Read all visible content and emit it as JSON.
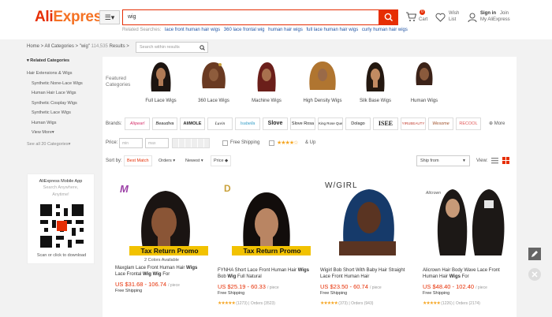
{
  "header": {
    "logo": "AliExpress",
    "menu_label": "☰▾",
    "search_value": "wig",
    "related_label": "Related Searches:",
    "related": [
      "lace front human hair wigs",
      "360 lace frontal wig",
      "human hair wigs",
      "full lace human hair wigs",
      "curly human hair wigs"
    ],
    "cart_label": "Cart",
    "cart_count": "0",
    "wish_line1": "Wish",
    "wish_line2": "List",
    "signin": "Sign in",
    "join": "Join",
    "my_ali": "My AliExpress"
  },
  "breadcrumb": {
    "path": "Home > All Categories > \"wig\"",
    "count": "114,535",
    "suffix": "Results >",
    "search_placeholder": "Search within results"
  },
  "sidebar": {
    "title": "▾ Related Categories",
    "items": [
      {
        "label": "Hair Extensions & Wigs",
        "indent": false
      },
      {
        "label": "Synthetic None-Lace Wigs",
        "indent": true
      },
      {
        "label": "Human Hair Lace Wigs",
        "indent": true
      },
      {
        "label": "Synthetic Cosplay Wigs",
        "indent": true
      },
      {
        "label": "Synthetic Lace Wigs",
        "indent": true
      },
      {
        "label": "Human Wigs",
        "indent": true
      },
      {
        "label": "View More▾",
        "indent": true
      }
    ],
    "see_all": "See all 20 Categories▾"
  },
  "mobile": {
    "title": "AliExpress Mobile App",
    "sub1": "Search Anywhere,",
    "sub2": "Anytime!",
    "cta": "Scan or click to download"
  },
  "featured": {
    "label_line1": "Featured",
    "label_line2": "Categories",
    "items": [
      "Full Lace Wigs",
      "360 Lace Wigs",
      "Machine Wigs",
      "High Density Wigs",
      "Silk Base Wigs",
      "Human Wigs"
    ]
  },
  "brands": {
    "label": "Brands:",
    "items": [
      "Alipearl",
      "Beaudiva",
      "AliMOLE",
      "Luvin",
      "Isabella",
      "Slove",
      "Slove Rosa",
      "King Rose Queen",
      "Dolago",
      "ISEE",
      "YIRUBEAUTY",
      "Wesome",
      "RECOOL"
    ],
    "more": "⊕ More"
  },
  "price_filter": {
    "label": "Price:",
    "min": "min",
    "max": "max",
    "free_shipping": "Free Shipping",
    "stars": "★★★★☆",
    "and_up": "& Up"
  },
  "sort": {
    "label": "Sort by:",
    "options": [
      "Best Match",
      "Orders ▾",
      "Newest ▾",
      "Price ◆"
    ],
    "ship_from": "Ship from",
    "view_label": "View:"
  },
  "products": [
    {
      "brand_mark": "M",
      "promo": "Tax Return Promo",
      "colors": "2 Colors Available",
      "title_pre": "Maxglam Lace Front Human Hair",
      "title_bold": "Wigs",
      "title_mid": "Lace Frontal",
      "title_bold2": "Wig Wig",
      "title_end": "For",
      "price": "US $31.68 - 106.74",
      "unit": "/ piece",
      "ship": "Free Shipping",
      "rating": "",
      "reviews": "",
      "orders": ""
    },
    {
      "brand_mark": "D",
      "promo": "Tax Return Promo",
      "colors": "",
      "title_pre": "FYNHA Short Lace Front Human Hair",
      "title_bold": "Wigs",
      "title_mid": "Bob",
      "title_bold2": "Wig",
      "title_end": "Full Natural",
      "price": "US $25.19 - 60.33",
      "unit": "/ piece",
      "ship": "Free Shipping",
      "rating": "★★★★★",
      "reviews": "(1273)",
      "orders": "Orders (3523)"
    },
    {
      "brand_mark": "W/GIRL",
      "promo": "",
      "colors": "",
      "title_pre": "Wigirl Bob Short With Baby Hair Straight Lace Front Human Hair",
      "title_bold": "",
      "title_mid": "",
      "title_bold2": "",
      "title_end": "",
      "price": "US $23.50 - 60.74",
      "unit": "/ piece",
      "ship": "Free Shipping",
      "rating": "★★★★★",
      "reviews": "(373)",
      "orders": "Orders (943)"
    },
    {
      "brand_mark": "Alicrown",
      "promo": "",
      "colors": "",
      "title_pre": "Alicrown Hair Body Wave Lace Front Human Hair",
      "title_bold": "Wigs",
      "title_mid": "For",
      "title_bold2": "",
      "title_end": "",
      "price": "US $48.40 - 102.40",
      "unit": "/ piece",
      "ship": "Free Shipping",
      "rating": "★★★★★",
      "reviews": "(1226)",
      "orders": "Orders (2174)"
    }
  ],
  "colors": {
    "brand": "#e62e04",
    "promo": "#f2c200",
    "star": "#f5a623"
  }
}
